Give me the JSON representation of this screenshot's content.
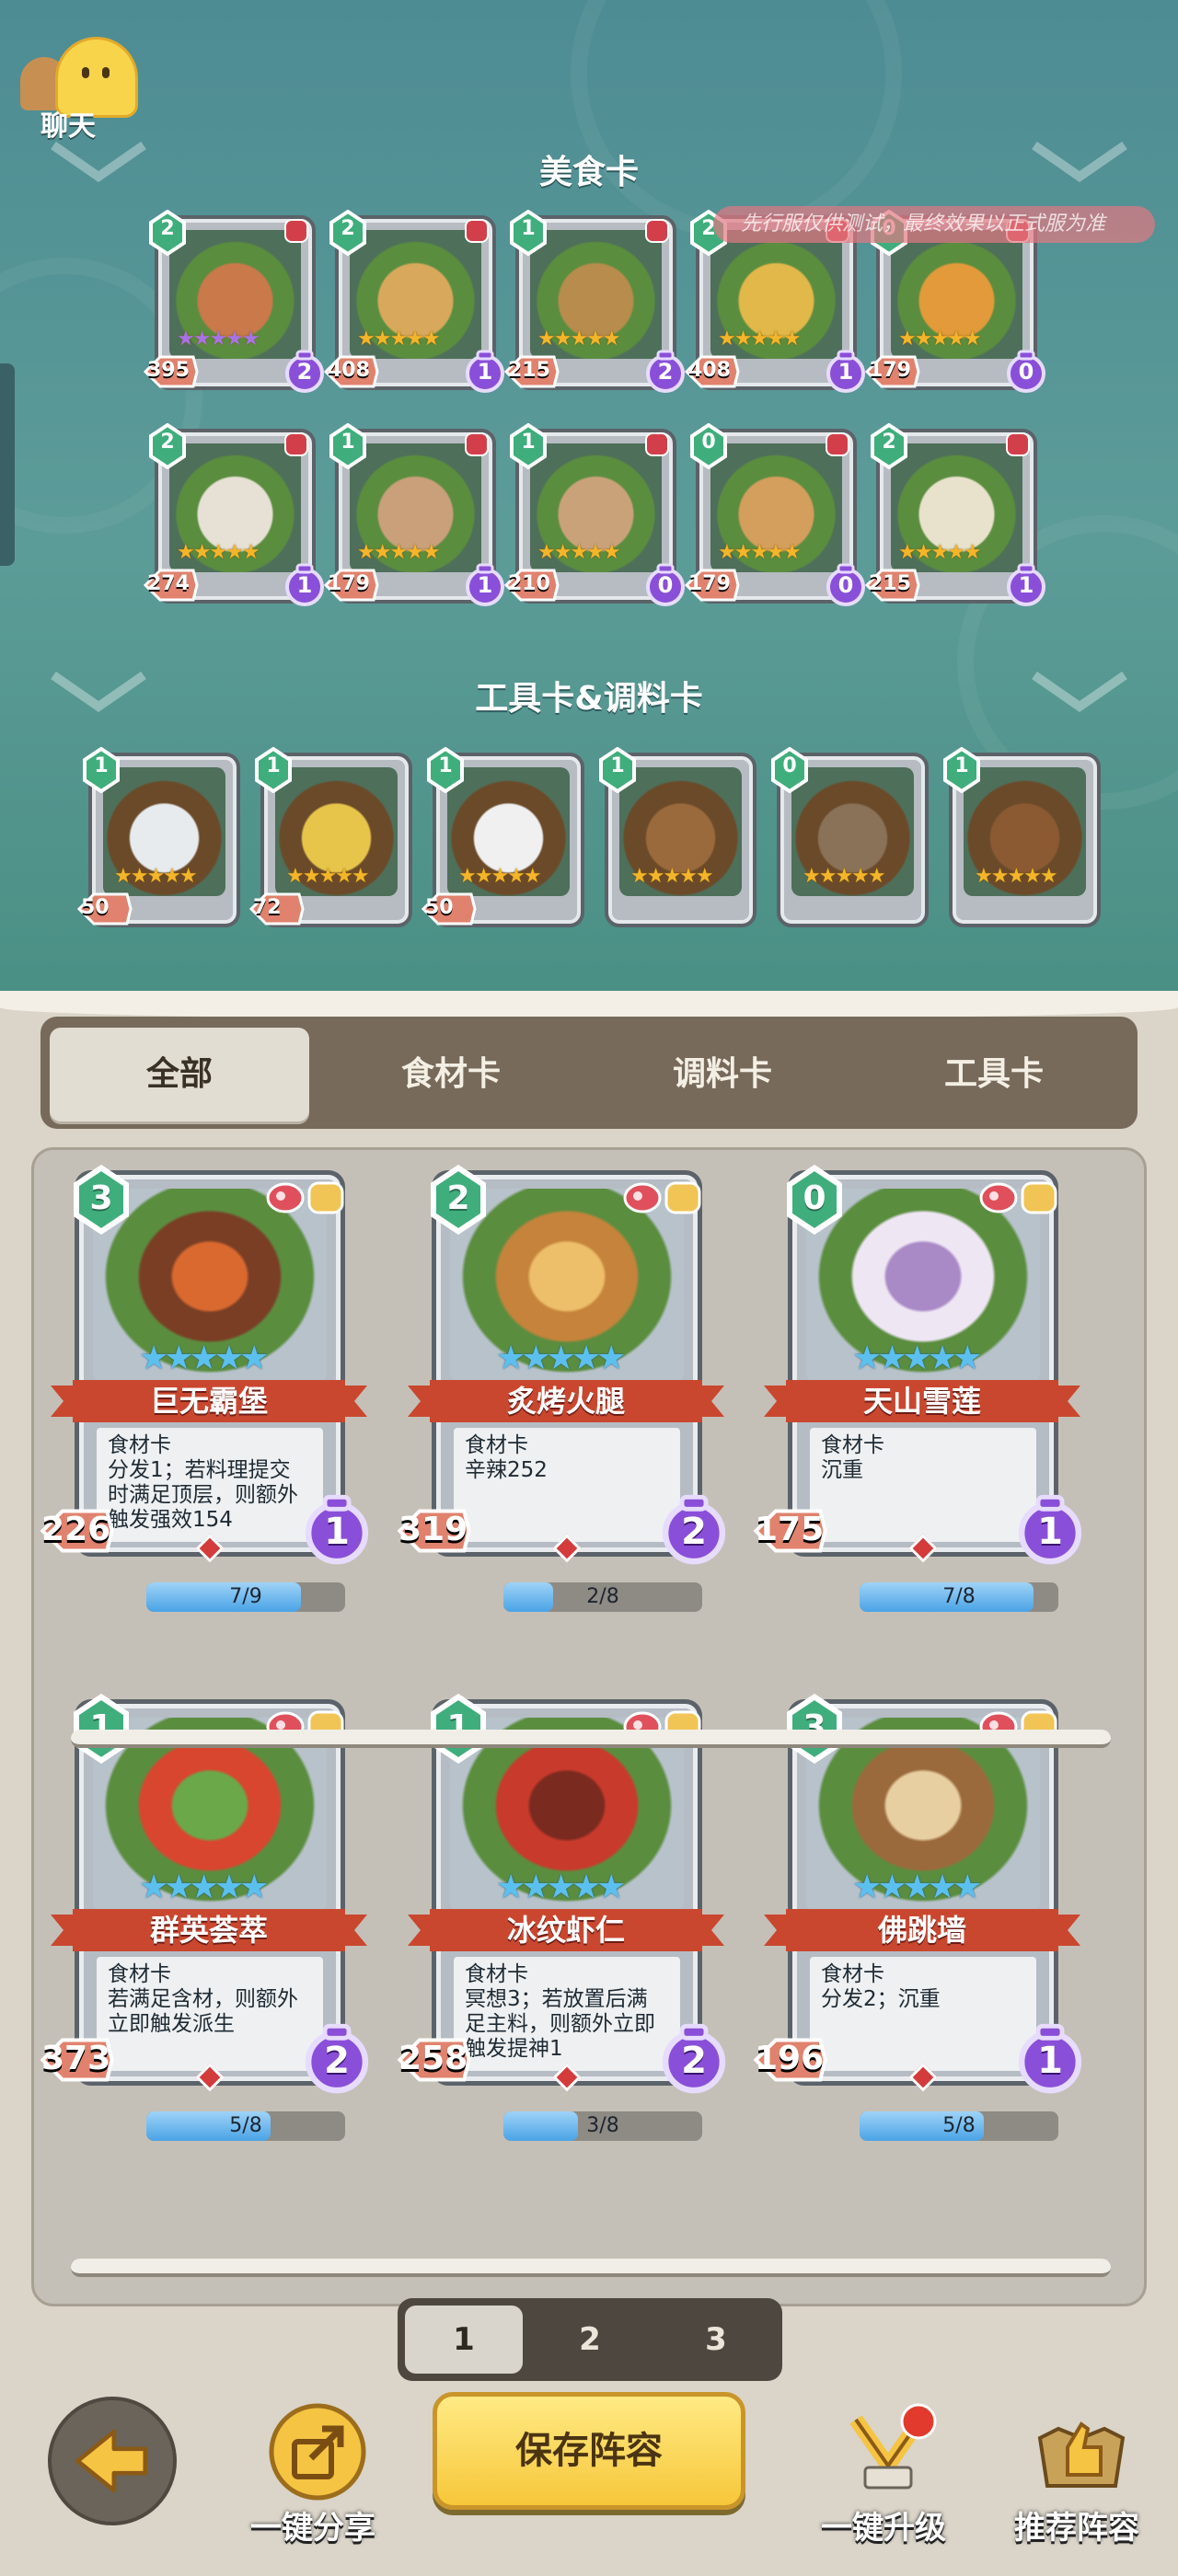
{
  "chat": {
    "label": "聊天",
    "icon": "chat-ghost-icon"
  },
  "notice": "先行服仅供测试，最终效果以正式服为准",
  "food_section": {
    "title": "美食卡",
    "cards": [
      {
        "cost": "2",
        "attack": "395",
        "level": "2",
        "stars": "★★★★★",
        "star_color": "purple"
      },
      {
        "cost": "2",
        "attack": "408",
        "level": "1",
        "stars": "★★★★★",
        "star_color": "gold"
      },
      {
        "cost": "1",
        "attack": "215",
        "level": "2",
        "stars": "★★★★★",
        "star_color": "gold"
      },
      {
        "cost": "2",
        "attack": "408",
        "level": "1",
        "stars": "★★★★★",
        "star_color": "gold"
      },
      {
        "cost": "0",
        "attack": "179",
        "level": "0",
        "stars": "★★★★★",
        "star_color": "gold"
      },
      {
        "cost": "2",
        "attack": "274",
        "level": "1",
        "stars": "★★★★★",
        "star_color": "gold"
      },
      {
        "cost": "1",
        "attack": "179",
        "level": "1",
        "stars": "★★★★★",
        "star_color": "gold"
      },
      {
        "cost": "1",
        "attack": "210",
        "level": "0",
        "stars": "★★★★★",
        "star_color": "gold"
      },
      {
        "cost": "0",
        "attack": "179",
        "level": "0",
        "stars": "★★★★★",
        "star_color": "gold"
      },
      {
        "cost": "2",
        "attack": "215",
        "level": "1",
        "stars": "★★★★★",
        "star_color": "gold"
      }
    ]
  },
  "tool_section": {
    "title": "工具卡&调料卡",
    "cards": [
      {
        "cost": "1",
        "attack": "50",
        "stars": "★★★★★"
      },
      {
        "cost": "1",
        "attack": "72",
        "stars": "★★★★★"
      },
      {
        "cost": "1",
        "attack": "50",
        "stars": "★★★★★"
      },
      {
        "cost": "1",
        "attack": "",
        "stars": "★★★★★"
      },
      {
        "cost": "0",
        "attack": "",
        "stars": "★★★★★"
      },
      {
        "cost": "1",
        "attack": "",
        "stars": "★★★★★"
      }
    ]
  },
  "filter_tabs": [
    "全部",
    "食材卡",
    "调料卡",
    "工具卡"
  ],
  "collection": [
    {
      "cost": "3",
      "name": "巨无霸堡",
      "stars": "★★★★★",
      "attack": "226",
      "level": "1",
      "progress_text": "7/9",
      "progress": 0.78,
      "desc": [
        "食材卡",
        "分发1；若料理提交",
        "时满足顶层，则额外",
        "触发强效154"
      ]
    },
    {
      "cost": "2",
      "name": "炙烤火腿",
      "stars": "★★★★★",
      "attack": "319",
      "level": "2",
      "progress_text": "2/8",
      "progress": 0.25,
      "desc": [
        "食材卡",
        "辛辣252"
      ]
    },
    {
      "cost": "0",
      "name": "天山雪莲",
      "stars": "★★★★★",
      "attack": "175",
      "level": "1",
      "progress_text": "7/8",
      "progress": 0.875,
      "desc": [
        "食材卡",
        "沉重"
      ]
    },
    {
      "cost": "1",
      "name": "群英荟萃",
      "stars": "★★★★★",
      "attack": "373",
      "level": "2",
      "progress_text": "5/8",
      "progress": 0.625,
      "desc": [
        "食材卡",
        "若满足含材，则额外",
        "立即触发派生"
      ]
    },
    {
      "cost": "1",
      "name": "冰纹虾仁",
      "stars": "★★★★★",
      "attack": "258",
      "level": "2",
      "progress_text": "3/8",
      "progress": 0.375,
      "desc": [
        "食材卡",
        "冥想3；若放置后满",
        "足主料，则额外立即",
        "触发提神1"
      ]
    },
    {
      "cost": "3",
      "name": "佛跳墙",
      "stars": "★★★★★",
      "attack": "196",
      "level": "1",
      "progress_text": "5/8",
      "progress": 0.625,
      "desc": [
        "食材卡",
        "分发2；沉重"
      ]
    }
  ],
  "pages": [
    "1",
    "2",
    "3"
  ],
  "actions": {
    "back_icon": "arrow-left-icon",
    "share": "一键分享",
    "save": "保存阵容",
    "upgrade": "一键升级",
    "recommend": "推荐阵容"
  },
  "colors": {
    "teal_bg": "#5c9c98",
    "gold_star": "#f5b52a",
    "blue_star": "#5cc0ef",
    "purple_level": "#8a4fd8",
    "green_cost": "#3fae7c",
    "red_banner": "#c9472f"
  }
}
